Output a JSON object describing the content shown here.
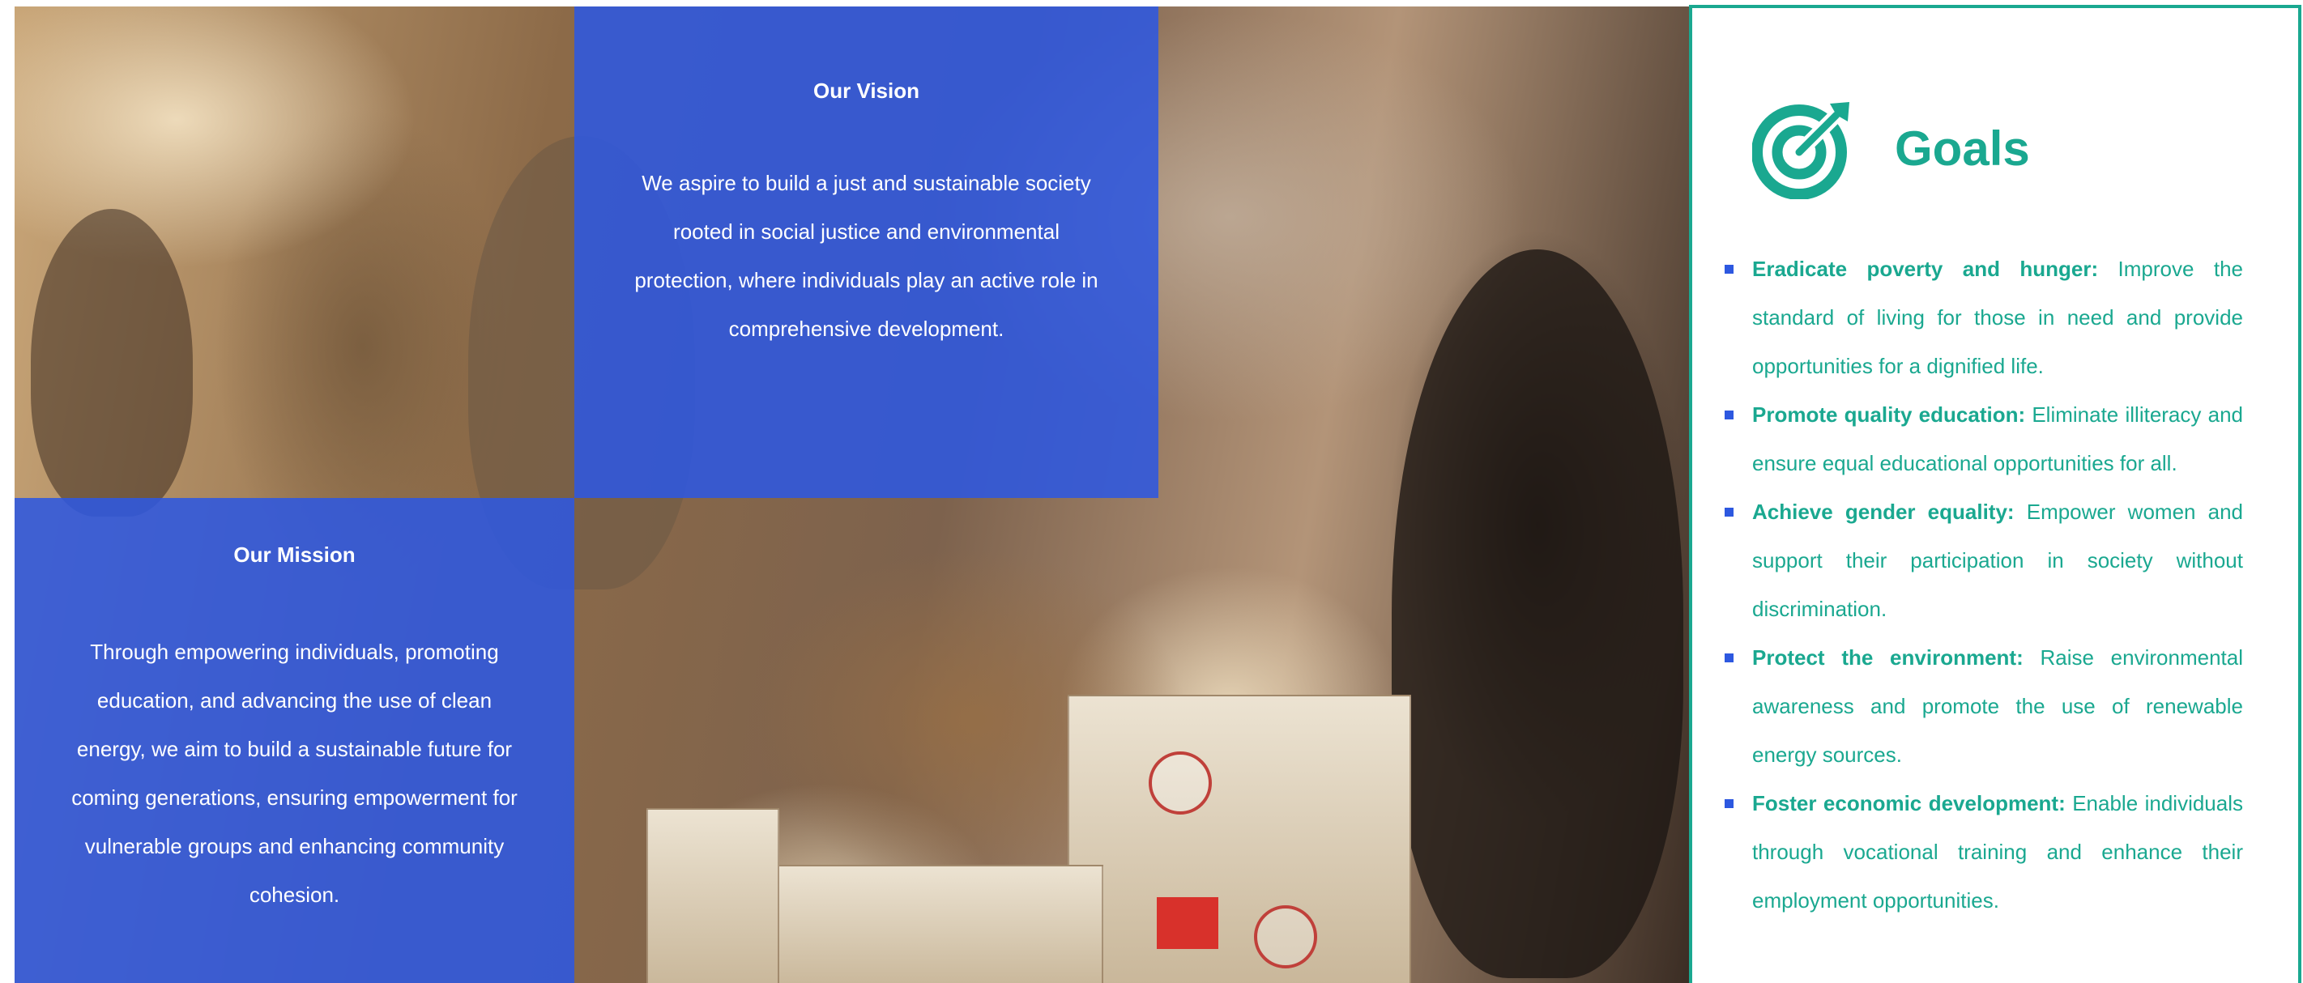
{
  "vision": {
    "title": "Our Vision",
    "text": "We aspire to build a just and sustainable society rooted in social justice and environmental protection, where individuals play an active role in comprehensive development."
  },
  "mission": {
    "title": "Our Mission",
    "text": "Through empowering individuals, promoting education, and advancing the use of clean energy, we aim to build a sustainable future for coming generations, ensuring empowerment for vulnerable groups and enhancing community cohesion."
  },
  "goals": {
    "title": "Goals",
    "icon": "target-icon",
    "accent_color": "#1aa890",
    "bullet_color": "#2d58e0",
    "items": [
      {
        "heading": "Eradicate poverty and hunger:",
        "text": " Improve the standard of living for those in need and provide opportunities for a dignified life."
      },
      {
        "heading": "Promote quality education:",
        "text": " Eliminate illiteracy and ensure equal educational opportunities for all."
      },
      {
        "heading": "Achieve gender equality:",
        "text": " Empower women and support their participation in society without discrimination."
      },
      {
        "heading": "Protect the environment:",
        "text": " Raise environmental awareness and promote the use of renewable energy sources."
      },
      {
        "heading": "Foster economic development:",
        "text": " Enable individuals through vocational training and enhance their employment opportunities."
      }
    ]
  },
  "panel_color": "#2d58e0"
}
